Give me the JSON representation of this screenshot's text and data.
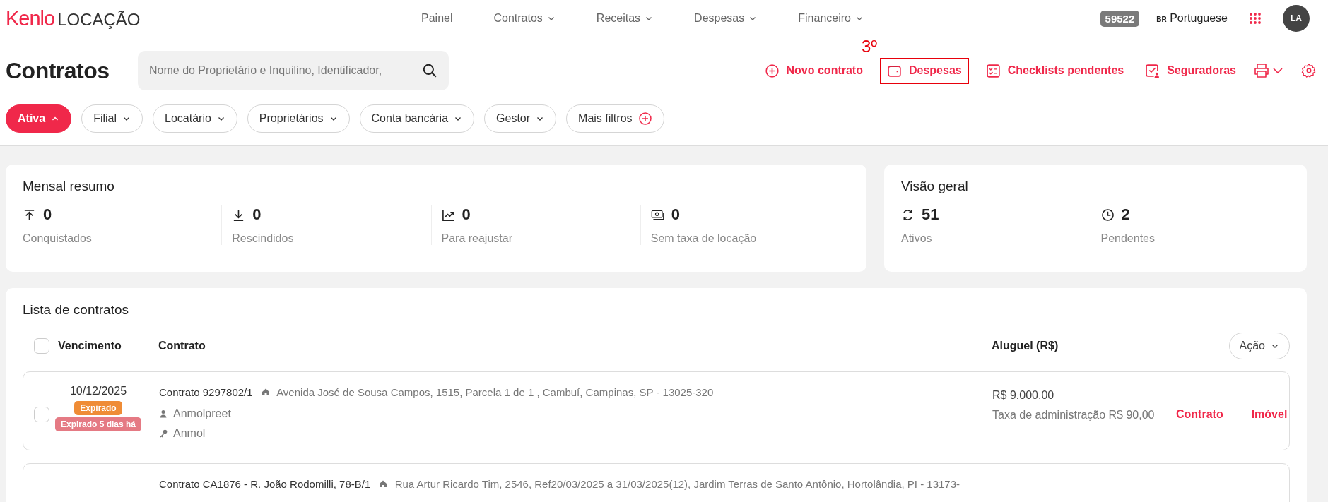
{
  "brand": {
    "logo": "Kenlo",
    "product": "LOCAÇÃO"
  },
  "nav": [
    {
      "label": "Painel",
      "dropdown": false
    },
    {
      "label": "Contratos",
      "dropdown": true
    },
    {
      "label": "Receitas",
      "dropdown": true
    },
    {
      "label": "Despesas",
      "dropdown": true
    },
    {
      "label": "Financeiro",
      "dropdown": true
    }
  ],
  "account_badge": "59522",
  "language": {
    "flag": "BR",
    "label": "Portuguese"
  },
  "avatar": "LA",
  "page_title": "Contratos",
  "search": {
    "placeholder": "Nome do Proprietário e Inquilino, Identificador,"
  },
  "actions": [
    {
      "label": "Novo contrato"
    },
    {
      "label": "Despesas",
      "annotation": "3º"
    },
    {
      "label": "Checklists pendentes"
    },
    {
      "label": "Seguradoras"
    }
  ],
  "filters": [
    {
      "label": "Ativa",
      "selected": true,
      "expanded": true
    },
    {
      "label": "Filial",
      "selected": false,
      "expanded": false
    },
    {
      "label": "Locatário",
      "selected": false,
      "expanded": false
    },
    {
      "label": "Proprietários",
      "selected": false,
      "expanded": false
    },
    {
      "label": "Conta bancária",
      "selected": false,
      "expanded": false
    },
    {
      "label": "Gestor",
      "selected": false,
      "expanded": false
    }
  ],
  "more_filters": "Mais filtros",
  "summary_cards": [
    {
      "title": "Mensal resumo",
      "stats": [
        {
          "value": "0",
          "label": "Conquistados"
        },
        {
          "value": "0",
          "label": "Rescindidos"
        },
        {
          "value": "0",
          "label": "Para reajustar"
        },
        {
          "value": "0",
          "label": "Sem taxa de locação"
        }
      ]
    },
    {
      "title": "Visão geral",
      "stats": [
        {
          "value": "51",
          "label": "Ativos"
        },
        {
          "value": "2",
          "label": "Pendentes"
        }
      ]
    }
  ],
  "contract_list": {
    "title": "Lista de contratos",
    "select_all_checked": false,
    "columns": [
      "Vencimento",
      "Contrato",
      "Aluguel (R$)"
    ],
    "action_button": "Ação",
    "rows": [
      {
        "checked": false,
        "date": "10/12/2025",
        "badges": [
          {
            "label": "Expirado",
            "color": "#ef8c36"
          },
          {
            "label": "Expirado 5 dias há",
            "color": "#e57a84"
          }
        ],
        "contract": "Contrato 9297802/1",
        "address": "Avenida José de Sousa Campos, 1515, Parcela 1 de 1 , Cambuí, Campinas, SP - 13025-320",
        "tenant": "Anmolpreet",
        "owner": "Anmol",
        "rent": "R$ 9.000,00",
        "fee": "Taxa de administração R$ 90,00",
        "links": [
          "Contrato",
          "Imóvel"
        ]
      },
      {
        "contract": "Contrato CA1876 - R. João Rodomilli, 78-B/1",
        "address": "Rua Artur Ricardo Tim, 2546, Ref20/03/2025 a 31/03/2025(12), Jardim Terras de Santo Antônio, Hortolândia, PI - 13173-"
      }
    ]
  }
}
